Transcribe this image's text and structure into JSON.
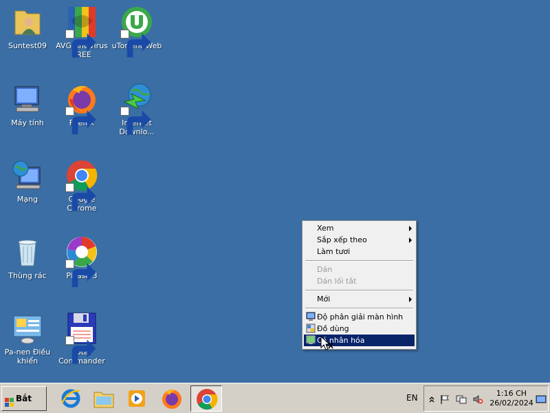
{
  "desktop": {
    "icons": [
      {
        "label": "Suntest09"
      },
      {
        "label": "AVG AntiVirus FREE"
      },
      {
        "label": "uTorrent Web"
      },
      {
        "label": "Máy tính"
      },
      {
        "label": "Firefox"
      },
      {
        "label": "Internet Downlo..."
      },
      {
        "label": "Mạng"
      },
      {
        "label": "Google Chrome"
      },
      {
        "label": "Thùng rác"
      },
      {
        "label": "Picasa 3"
      },
      {
        "label": "Pa-nen Điều khiển"
      },
      {
        "label": "Total Commander"
      }
    ]
  },
  "context_menu": {
    "items": [
      {
        "label": "Xem"
      },
      {
        "label": "Sắp xếp theo"
      },
      {
        "label": "Làm tươi"
      },
      {
        "label": "Dán"
      },
      {
        "label": "Dán lối tắt"
      },
      {
        "label": "Mới"
      },
      {
        "label": "Độ phân giải màn hình"
      },
      {
        "label": "Đồ dùng"
      },
      {
        "label": "Cá nhân hóa"
      }
    ]
  },
  "taskbar": {
    "start_label": "Bắt đầu",
    "language": "EN",
    "clock_time": "1:16 CH",
    "clock_date": "26/02/2024"
  },
  "colors": {
    "desktop": "#3a6ea5",
    "menu_highlight": "#0a246a",
    "taskbar": "#d4d0c8"
  }
}
